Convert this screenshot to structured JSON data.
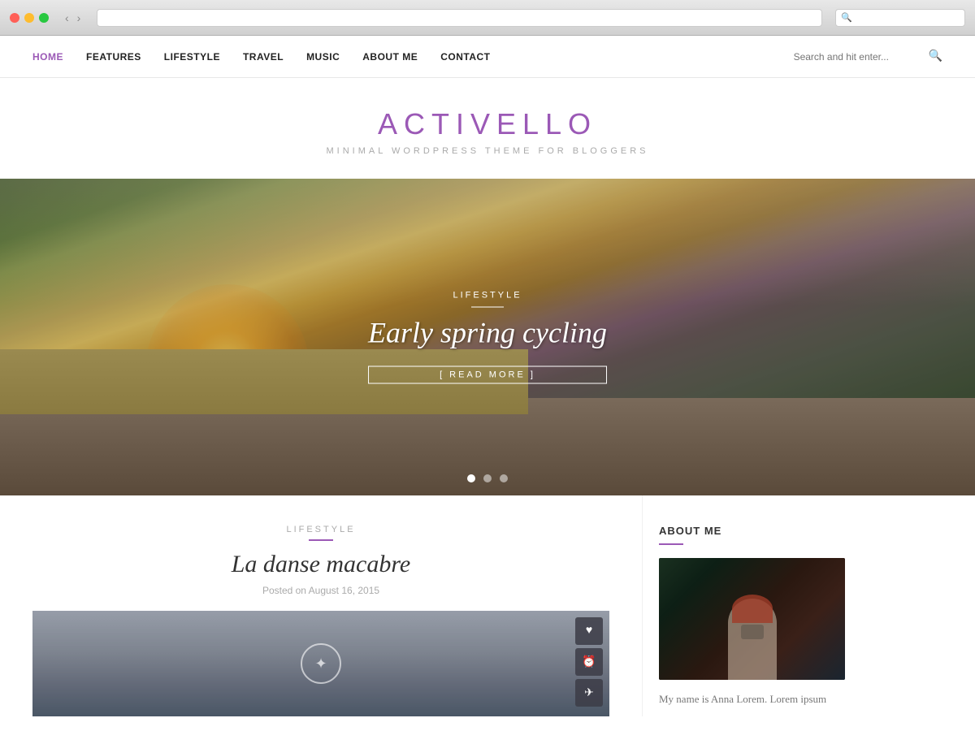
{
  "mac": {
    "address_bar_placeholder": "",
    "search_placeholder": ""
  },
  "nav": {
    "items": [
      {
        "label": "HOME",
        "active": true
      },
      {
        "label": "FEATURES",
        "active": false
      },
      {
        "label": "LIFESTYLE",
        "active": false
      },
      {
        "label": "TRAVEL",
        "active": false
      },
      {
        "label": "MUSIC",
        "active": false
      },
      {
        "label": "ABOUT ME",
        "active": false
      },
      {
        "label": "CONTACT",
        "active": false
      }
    ],
    "search_placeholder": "Search and hit enter..."
  },
  "brand": {
    "title": "ACTIVELLO",
    "subtitle": "MINIMAL WORDPRESS THEME FOR BLOGGERS"
  },
  "hero": {
    "category": "LIFESTYLE",
    "title": "Early spring cycling",
    "read_more": "[ READ MORE ]",
    "dots": [
      {
        "active": true
      },
      {
        "active": false
      },
      {
        "active": false
      }
    ]
  },
  "post": {
    "category": "LIFESTYLE",
    "title": "La danse macabre",
    "date": "Posted on August 16, 2015",
    "actions": [
      "♥",
      "⏰",
      "✈"
    ]
  },
  "sidebar": {
    "about_title": "ABOUT ME",
    "about_text": "My name is Anna Lorem. Lorem ipsum"
  }
}
